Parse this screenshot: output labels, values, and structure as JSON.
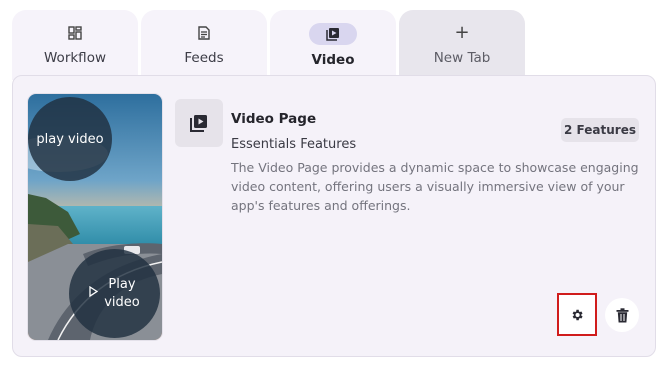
{
  "tabs": [
    {
      "label": "Workflow",
      "icon": "dashboard-icon"
    },
    {
      "label": "Feeds",
      "icon": "document-icon"
    },
    {
      "label": "Video",
      "icon": "video-library-icon",
      "active": true
    },
    {
      "label": "New Tab",
      "icon": "plus-icon"
    }
  ],
  "card": {
    "title": "Video Page",
    "subtitle": "Essentials Features",
    "description": "The Video Page provides a dynamic space to showcase engaging video content, offering users a visually immersive view of your app's features and offerings.",
    "badge": "2 Features",
    "thumbnail": {
      "play_top": "play video",
      "play_bottom_line1": "Play",
      "play_bottom_line2": "video"
    },
    "actions": {
      "settings_icon": "gear-icon",
      "delete_icon": "trash-icon"
    }
  },
  "colors": {
    "highlight_border": "#d01c1c",
    "active_tab_pill": "#d9d6ef",
    "panel_bg": "#f5f2f9"
  }
}
